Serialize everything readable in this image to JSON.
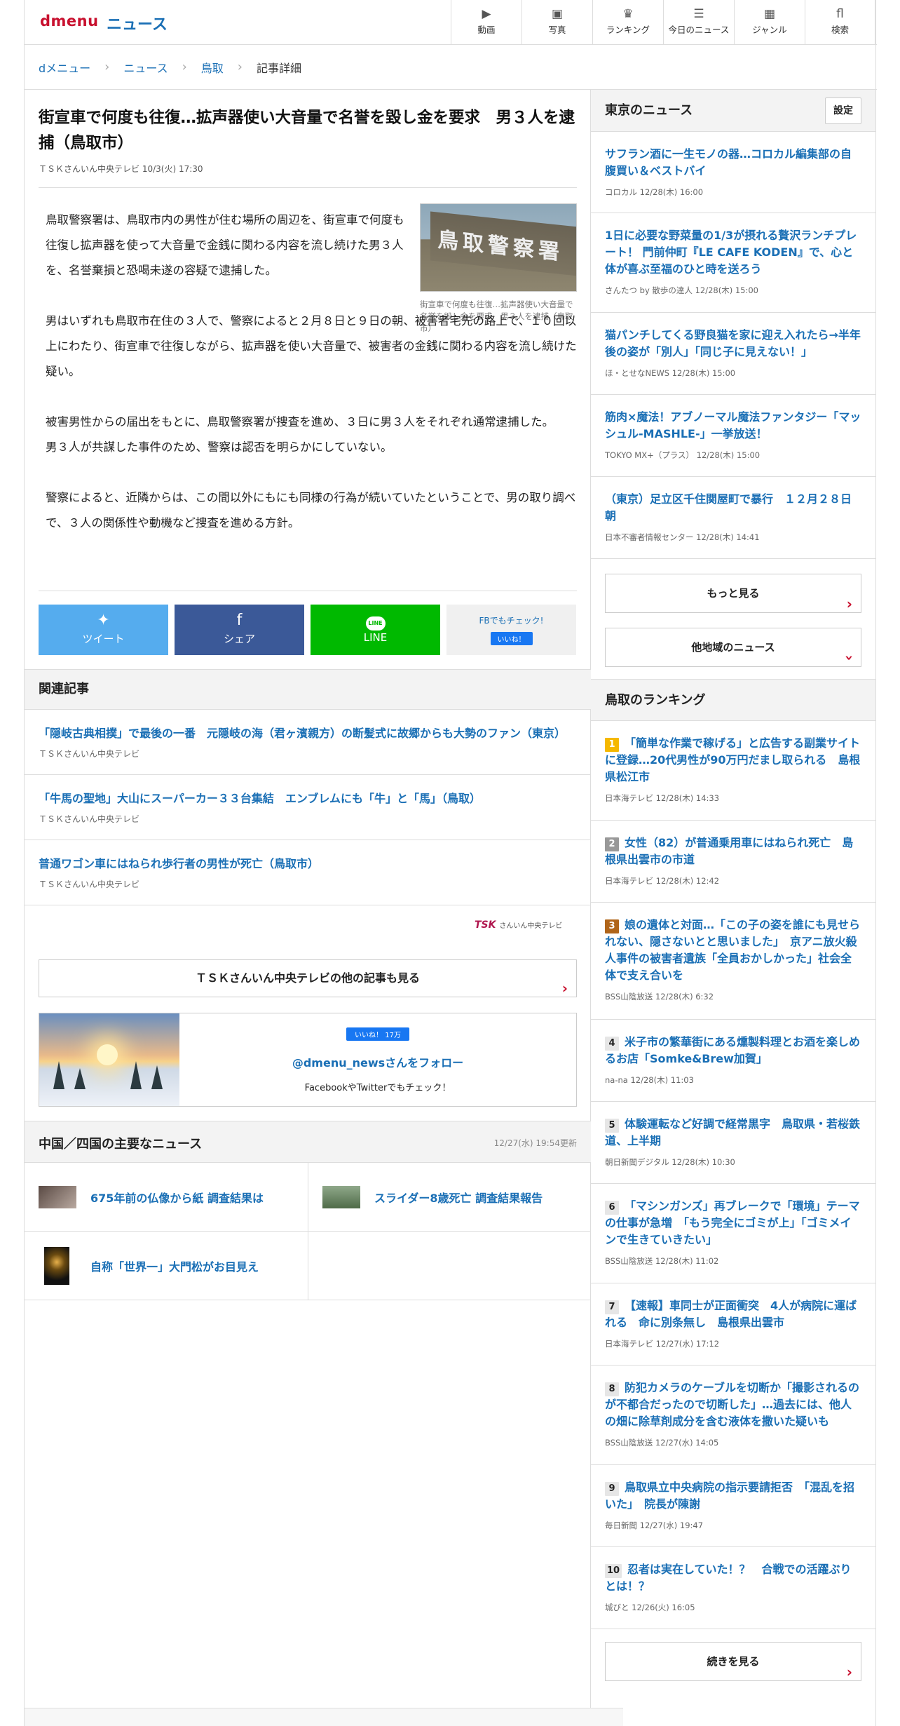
{
  "header": {
    "logo": "dmenu",
    "section": "ニュース",
    "nav": [
      {
        "icon": "video-icon",
        "glyph": "▶",
        "label": "動画"
      },
      {
        "icon": "photo-icon",
        "glyph": "▣",
        "label": "写真"
      },
      {
        "icon": "ranking-icon",
        "glyph": "♛",
        "label": "ランキング"
      },
      {
        "icon": "today-news-icon",
        "glyph": "☰",
        "label": "今日のニュース"
      },
      {
        "icon": "genre-icon",
        "glyph": "▦",
        "label": "ジャンル"
      },
      {
        "icon": "search-icon",
        "glyph": "fl",
        "label": "検索"
      }
    ]
  },
  "breadcrumb": [
    "dメニュー",
    "ニュース",
    "鳥取",
    "記事詳細"
  ],
  "article": {
    "title": "街宣車で何度も往復…拡声器使い大音量で名誉を毀し金を要求　男３人を逮捕（鳥取市）",
    "source": "ＴＳＫさんいん中央テレビ 10/3(火) 17:30",
    "photo_text": "鳥取警察署",
    "photo_caption": "街宣車で何度も往復…拡声器使い大音量で名誉を毀し金を要求　男３人を逮捕（鳥取市）",
    "paragraphs": [
      "鳥取警察署は、鳥取市内の男性が住む場所の周辺を、街宣車で何度も往復し拡声器を使って大音量で金銭に関わる内容を流し続けた男３人を、名誉棄損と恐喝未遂の容疑で逮捕した。",
      "男はいずれも鳥取市在住の３人で、警察によると２月８日と９日の朝、被害者宅先の路上で、１０回以上にわたり、街宣車で往復しながら、拡声器を使い大音量で、被害者の金銭に関わる内容を流し続けた疑い。",
      "被害男性からの届出をもとに、鳥取警察署が捜査を進め、３日に男３人をそれぞれ通常逮捕した。",
      "男３人が共謀した事件のため、警察は認否を明らかにしていない。",
      "警察によると、近隣からは、この間以外にもにも同様の行為が続いていたということで、男の取り調べで、３人の関係性や動機など捜査を進める方針。"
    ]
  },
  "share": {
    "tweet": "ツイート",
    "share": "シェア",
    "line": "LINE",
    "line_badge": "LINE",
    "fb_check": "FBでもチェック!",
    "fb_like": "いいね！"
  },
  "related": {
    "heading": "関連記事",
    "items": [
      {
        "title": "「隠岐古典相撲」で最後の一番　元隠岐の海（君ヶ濱親方）の断髪式に故郷からも大勢のファン（東京）",
        "source": "ＴＳＫさんいん中央テレビ"
      },
      {
        "title": "「牛馬の聖地」大山にスーパーカー３３台集結　エンブレムにも「牛」と「馬」（鳥取）",
        "source": "ＴＳＫさんいん中央テレビ"
      },
      {
        "title": "普通ワゴン車にはねられ歩行者の男性が死亡（鳥取市）",
        "source": "ＴＳＫさんいん中央テレビ"
      }
    ],
    "tsk_logo": "TSK",
    "tsk_logo_sub": "さんいん中央テレビ",
    "more_tsk": "ＴＳＫさんいん中央テレビの他の記事も見る"
  },
  "follow": {
    "like": "いいね！ 17万",
    "handle": "@dmenu_newsさんをフォロー",
    "sub": "FacebookやTwitterでもチェック！"
  },
  "regional": {
    "heading": "中国／四国の主要なニュース",
    "updated": "12/27(水) 19:54更新",
    "items": [
      {
        "title": "675年前の仏像から紙 調査結果は"
      },
      {
        "title": "スライダー8歳死亡 調査結果報告"
      },
      {
        "title": "自称「世界一」大門松がお目見え"
      }
    ]
  },
  "sidebar": {
    "tokyo_heading": "東京のニュース",
    "settings": "設定",
    "tokyo": [
      {
        "title": "サフラン酒に一生モノの器…コロカル編集部の自腹買い＆ベストバイ",
        "meta": "コロカル  12/28(木) 16:00"
      },
      {
        "title": "1日に必要な野菜量の1/3が摂れる贅沢ランチプレート！ 門前仲町『LE CAFE KODEN』で、心と体が喜ぶ至福のひと時を送ろう",
        "meta": "さんたつ by 散歩の達人  12/28(木) 15:00"
      },
      {
        "title": "猫パンチしてくる野良猫を家に迎え入れたら→半年後の姿が「別人」「同じ子に見えない！」",
        "meta": "ほ・とせなNEWS  12/28(木) 15:00"
      },
      {
        "title": "筋肉×魔法！アブノーマル魔法ファンタジー「マッシュル-MASHLE-」一挙放送！",
        "meta": "TOKYO MX+（プラス）  12/28(木) 15:00"
      },
      {
        "title": "（東京）足立区千住関屋町で暴行　１２月２８日朝",
        "meta": "日本不審者情報センター  12/28(木) 14:41"
      }
    ],
    "more": "もっと見る",
    "other_regions": "他地域のニュース",
    "ranking_heading": "鳥取のランキング",
    "ranking": [
      {
        "rank": "1",
        "title": "「簡単な作業で稼げる」と広告する副業サイトに登録…20代男性が90万円だまし取られる　島根県松江市",
        "meta": "日本海テレビ  12/28(木) 14:33"
      },
      {
        "rank": "2",
        "title": "女性（82）が普通乗用車にはねられ死亡　島根県出雲市の市道",
        "meta": "日本海テレビ  12/28(木) 12:42"
      },
      {
        "rank": "3",
        "title": "娘の遺体と対面…「この子の姿を誰にも見せられない、隠さないとと思いました」　京アニ放火殺人事件の被害者遺族「全員おかしかった」社会全体で支え合いを",
        "meta": "BSS山陰放送  12/28(木) 6:32"
      },
      {
        "rank": "4",
        "title": "米子市の繁華街にある燻製料理とお酒を楽しめるお店「Somke&Brew加賀」",
        "meta": "na-na  12/28(木) 11:03"
      },
      {
        "rank": "5",
        "title": "体験運転など好調で経常黒字　鳥取県・若桜鉄道、上半期",
        "meta": "朝日新聞デジタル  12/28(木) 10:30"
      },
      {
        "rank": "6",
        "title": "「マシンガンズ」再ブレークで「環境」テーマの仕事が急増　「もう完全にゴミが上」「ゴミメインで生きていきたい」",
        "meta": "BSS山陰放送  12/28(木) 11:02"
      },
      {
        "rank": "7",
        "title": "【速報】車同士が正面衝突　4人が病院に運ばれる　命に別条無し　島根県出雲市",
        "meta": "日本海テレビ  12/27(水) 17:12"
      },
      {
        "rank": "8",
        "title": "防犯カメラのケーブルを切断か「撮影されるのが不都合だったので切断した」…過去には、他人の畑に除草剤成分を含む液体を撒いた疑いも",
        "meta": "BSS山陰放送  12/27(水) 14:05"
      },
      {
        "rank": "9",
        "title": "鳥取県立中央病院の指示要請拒否　「混乱を招いた」　院長が陳謝",
        "meta": "毎日新聞  12/27(水) 19:47"
      },
      {
        "rank": "10",
        "title": "忍者は実在していた！？　合戦での活躍ぶりとは！？",
        "meta": "城びと  12/26(火) 16:05"
      }
    ],
    "continue": "続きを見る"
  },
  "colors": {
    "brand_red": "#c8102e",
    "link_blue": "#1a6fb5",
    "twitter": "#55acee",
    "facebook": "#3b5998",
    "line": "#00b900"
  }
}
